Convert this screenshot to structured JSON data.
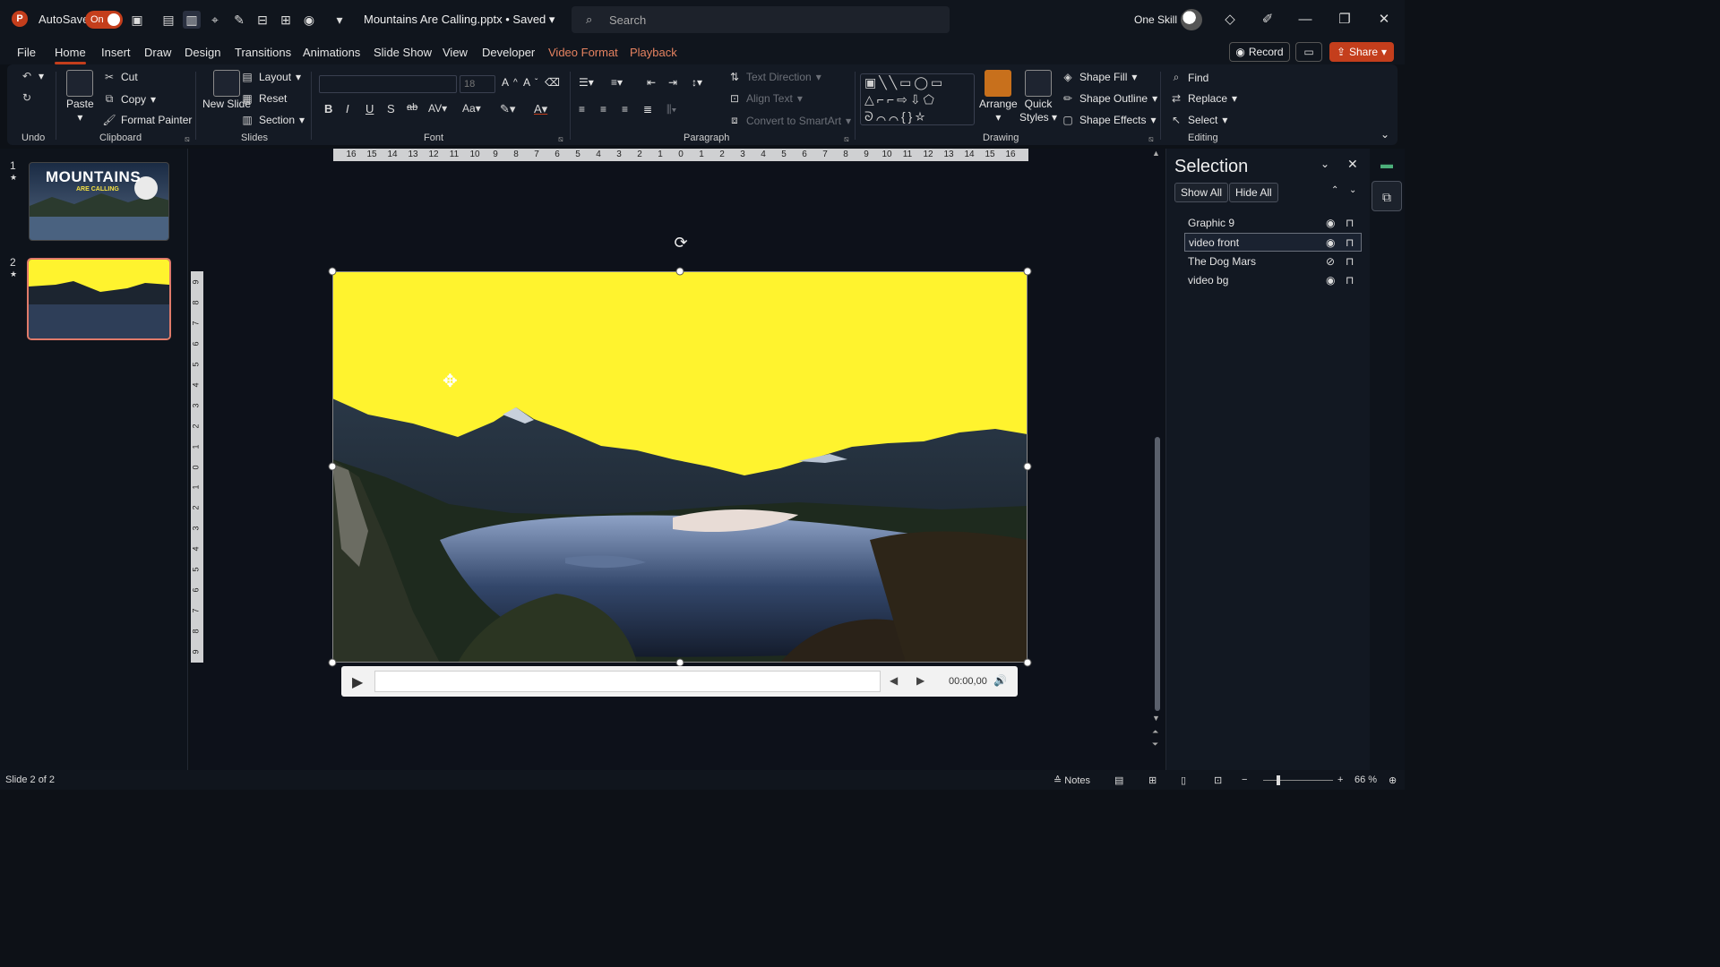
{
  "titlebar": {
    "app_letter": "P",
    "autosave_label": "AutoSave",
    "autosave_state": "On",
    "doc_title": "Mountains Are Calling.pptx • Saved",
    "search_placeholder": "Search",
    "user_name": "One Skill"
  },
  "tabs": [
    "File",
    "Home",
    "Insert",
    "Draw",
    "Design",
    "Transitions",
    "Animations",
    "Slide Show",
    "View",
    "Developer",
    "Video Format",
    "Playback"
  ],
  "actions": {
    "record": "Record",
    "share": "Share"
  },
  "ribbon": {
    "undo_group": "Undo",
    "clipboard": {
      "paste": "Paste",
      "cut": "Cut",
      "copy": "Copy",
      "format_painter": "Format Painter",
      "label": "Clipboard"
    },
    "slides": {
      "new_slide": "New Slide",
      "layout": "Layout",
      "reset": "Reset",
      "section": "Section",
      "label": "Slides"
    },
    "font": {
      "size": "18",
      "label": "Font",
      "bold": "B",
      "italic": "I",
      "underline": "U",
      "shadow": "S",
      "strike": "ab",
      "spacing": "AV",
      "case": "Aa",
      "color": "A"
    },
    "paragraph": {
      "text_direction": "Text Direction",
      "align_text": "Align Text",
      "smartart": "Convert to SmartArt",
      "label": "Paragraph"
    },
    "drawing": {
      "arrange": "Arrange",
      "quick_styles": "Quick Styles",
      "shape_fill": "Shape Fill",
      "shape_outline": "Shape Outline",
      "shape_effects": "Shape Effects",
      "label": "Drawing"
    },
    "editing": {
      "find": "Find",
      "replace": "Replace",
      "select": "Select",
      "label": "Editing"
    }
  },
  "thumbnails": [
    {
      "number": "1",
      "title": "MOUNTAINS",
      "subtitle": "ARE CALLING"
    },
    {
      "number": "2"
    }
  ],
  "ruler": {
    "horizontal": [
      "16",
      "15",
      "14",
      "13",
      "12",
      "11",
      "10",
      "9",
      "8",
      "7",
      "6",
      "5",
      "4",
      "3",
      "2",
      "1",
      "0",
      "1",
      "2",
      "3",
      "4",
      "5",
      "6",
      "7",
      "8",
      "9",
      "10",
      "11",
      "12",
      "13",
      "14",
      "15",
      "16"
    ],
    "vertical": [
      "9",
      "8",
      "7",
      "6",
      "5",
      "4",
      "3",
      "2",
      "1",
      "0",
      "1",
      "2",
      "3",
      "4",
      "5",
      "6",
      "7",
      "8",
      "9"
    ]
  },
  "player": {
    "time": "00:00,00"
  },
  "selection_pane": {
    "title": "Selection",
    "show_all": "Show All",
    "hide_all": "Hide All",
    "items": [
      {
        "name": "Graphic 9",
        "visible": true,
        "selected": false
      },
      {
        "name": "video front",
        "visible": true,
        "selected": true
      },
      {
        "name": "The Dog Mars",
        "visible": false,
        "selected": false
      },
      {
        "name": "video bg",
        "visible": true,
        "selected": false
      }
    ]
  },
  "statusbar": {
    "slide_info": "Slide 2 of 2",
    "notes": "Notes",
    "zoom": "66 %"
  },
  "colors": {
    "accent": "#c43e1c",
    "sky_yellow": "#fff32e",
    "canvas_bg": "#0d111a"
  }
}
